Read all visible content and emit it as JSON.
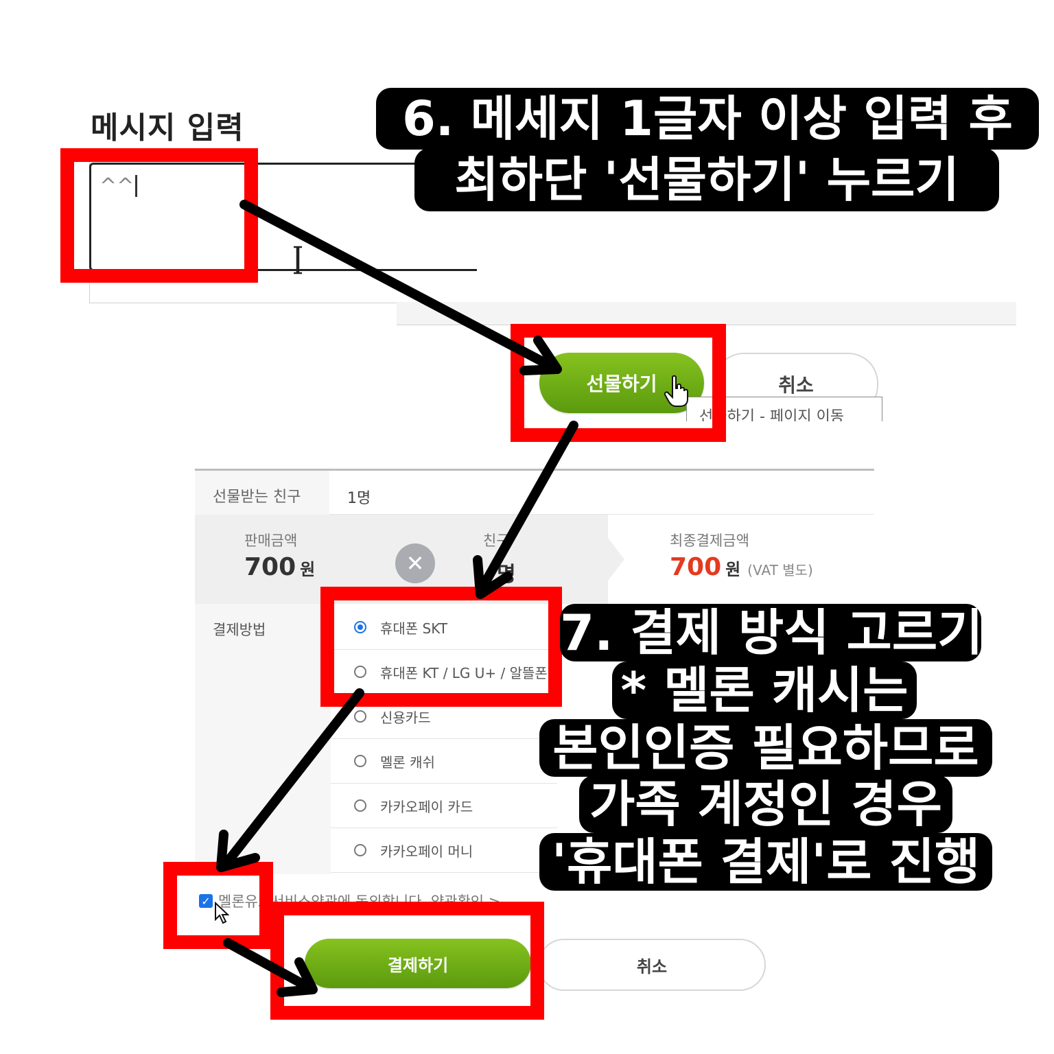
{
  "step6": {
    "caption_line1": "6. 메세지 1글자 이상 입력 후",
    "caption_line2": "최하단 '선물하기' 누르기"
  },
  "message": {
    "title": "메시지 입력",
    "value": "^^"
  },
  "gift_form": {
    "gift_button": "선물하기",
    "cancel_button": "취소",
    "tooltip": "선물하기 - 페이지 이동"
  },
  "payment": {
    "friend_label": "선물받는 친구",
    "friend_count": "1명",
    "sale_label": "판매금액",
    "sale_amount": "700",
    "won": "원",
    "count_label": "친구",
    "count_value": "명",
    "multiply_symbol": "✕",
    "final_label": "최종결제금액",
    "final_amount": "700",
    "vat_note": "(VAT 별도)",
    "method_label": "결제방법",
    "methods": [
      {
        "label": "휴대폰 SKT",
        "selected": true
      },
      {
        "label": "휴대폰 KT / LG U+ / 알뜰폰",
        "selected": false
      },
      {
        "label": "신용카드",
        "selected": false
      },
      {
        "label": "멜론 캐쉬",
        "selected": false
      },
      {
        "label": "카카오페이 카드",
        "selected": false
      },
      {
        "label": "카카오페이 머니",
        "selected": false
      }
    ],
    "agree_checked": true,
    "agree_text": "멜론유료서비스약관에 동의합니다. 약관확인 >",
    "pay_button": "결제하기",
    "cancel_button": "취소"
  },
  "step7": {
    "caption_line1": "7. 결제 방식 고르기",
    "caption_line2": "* 멜론 캐시는",
    "caption_line3": "본인인증 필요하므로",
    "caption_line4": "가족 계정인 경우",
    "caption_line5": "'휴대폰 결제'로 진행"
  },
  "colors": {
    "highlight_red": "#ff0000",
    "button_green": "#6aaa12",
    "price_red": "#e53a20",
    "radio_blue": "#1a73e8"
  }
}
